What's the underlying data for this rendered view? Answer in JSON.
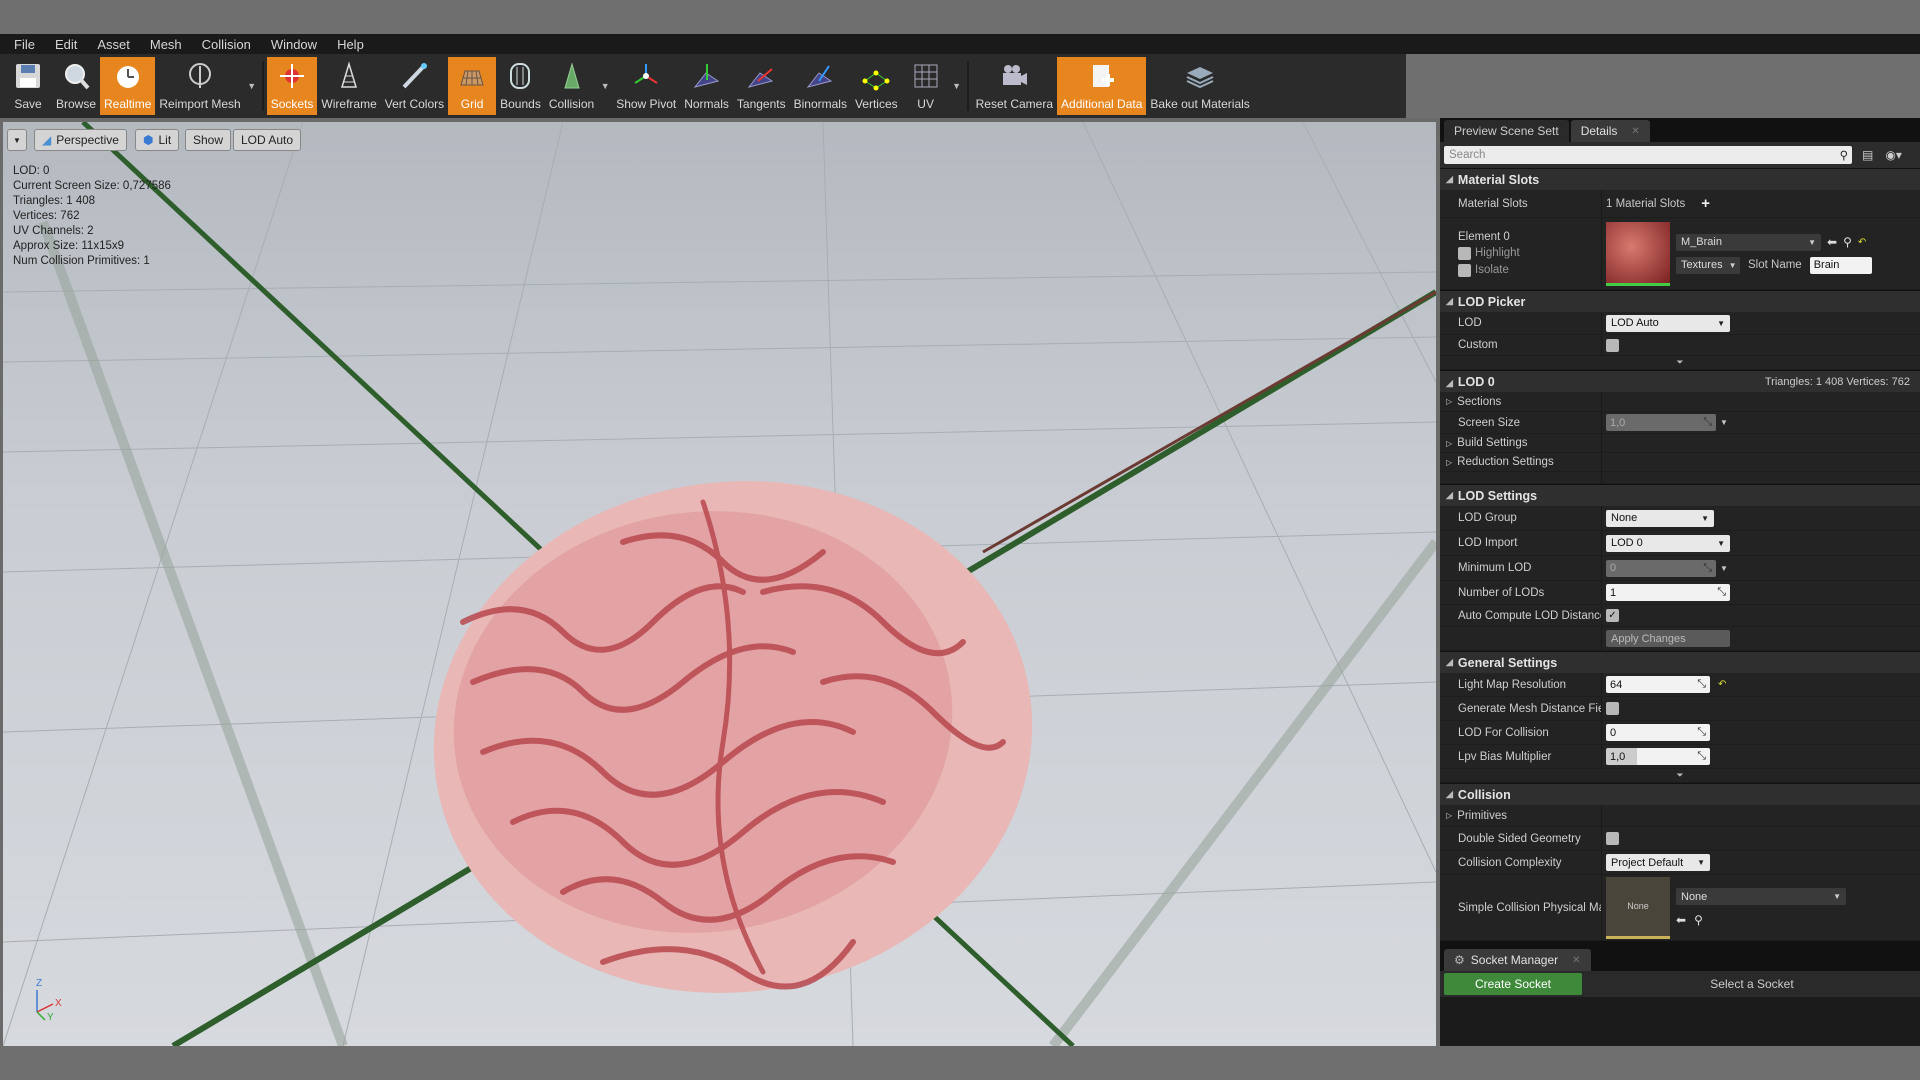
{
  "menu": [
    "File",
    "Edit",
    "Asset",
    "Mesh",
    "Collision",
    "Window",
    "Help"
  ],
  "toolbar": [
    {
      "label": "Save",
      "icon": "save-icon",
      "active": false
    },
    {
      "label": "Browse",
      "icon": "browse-icon",
      "active": false
    },
    {
      "label": "Realtime",
      "icon": "realtime-icon",
      "active": true
    },
    {
      "label": "Reimport Mesh",
      "icon": "reimport-icon",
      "active": false
    },
    {
      "label": "Sockets",
      "icon": "sockets-icon",
      "active": true
    },
    {
      "label": "Wireframe",
      "icon": "wireframe-icon",
      "active": false
    },
    {
      "label": "Vert Colors",
      "icon": "vert-colors-icon",
      "active": false
    },
    {
      "label": "Grid",
      "icon": "grid-icon",
      "active": true
    },
    {
      "label": "Bounds",
      "icon": "bounds-icon",
      "active": false
    },
    {
      "label": "Collision",
      "icon": "collision-icon",
      "active": false
    },
    {
      "label": "Show Pivot",
      "icon": "pivot-icon",
      "active": false
    },
    {
      "label": "Normals",
      "icon": "normals-icon",
      "active": false
    },
    {
      "label": "Tangents",
      "icon": "tangents-icon",
      "active": false
    },
    {
      "label": "Binormals",
      "icon": "binormals-icon",
      "active": false
    },
    {
      "label": "Vertices",
      "icon": "vertices-icon",
      "active": false
    },
    {
      "label": "UV",
      "icon": "uv-icon",
      "active": false
    },
    {
      "label": "Reset Camera",
      "icon": "camera-icon",
      "active": false
    },
    {
      "label": "Additional Data",
      "icon": "additional-data-icon",
      "active": true
    },
    {
      "label": "Bake out Materials",
      "icon": "bake-icon",
      "active": false
    }
  ],
  "viewport": {
    "perspective": "Perspective",
    "lit": "Lit",
    "show": "Show",
    "lod": "LOD Auto",
    "stats": [
      "LOD:  0",
      "Current Screen Size:  0,727586",
      "Triangles:  1 408",
      "Vertices:  762",
      "UV Channels:  2",
      "Approx Size: 11x15x9",
      "Num Collision Primitives:  1"
    ],
    "axis": {
      "z": "Z",
      "x": "X",
      "y": "Y"
    }
  },
  "panel": {
    "tabs": [
      "Preview Scene Sett",
      "Details"
    ],
    "search_placeholder": "Search",
    "material_slots": {
      "header": "Material Slots",
      "label": "Material Slots",
      "value": "1 Material Slots",
      "element": "Element 0",
      "highlight": "Highlight",
      "isolate": "Isolate",
      "material": "M_Brain",
      "textures": "Textures",
      "slot_name_label": "Slot Name",
      "slot_name": "Brain"
    },
    "lod_picker": {
      "header": "LOD Picker",
      "lod_label": "LOD",
      "lod_value": "LOD Auto",
      "custom_label": "Custom"
    },
    "lod0": {
      "header": "LOD 0",
      "stats": "Triangles: 1 408   Vertices: 762",
      "sections": "Sections",
      "screen_size_label": "Screen Size",
      "screen_size": "1,0",
      "build": "Build Settings",
      "reduction": "Reduction Settings"
    },
    "lod_settings": {
      "header": "LOD Settings",
      "group_label": "LOD Group",
      "group": "None",
      "import_label": "LOD Import",
      "import": "LOD 0",
      "min_label": "Minimum LOD",
      "min": "0",
      "num_label": "Number of LODs",
      "num": "1",
      "auto_label": "Auto Compute LOD Distance",
      "apply": "Apply Changes"
    },
    "general": {
      "header": "General Settings",
      "lightmap_label": "Light Map Resolution",
      "lightmap": "64",
      "distance_label": "Generate Mesh Distance Fiel",
      "lodcol_label": "LOD For Collision",
      "lodcol": "0",
      "lpv_label": "Lpv Bias Multiplier",
      "lpv": "1,0"
    },
    "collision": {
      "header": "Collision",
      "primitives": "Primitives",
      "double_label": "Double Sided Geometry",
      "complexity_label": "Collision Complexity",
      "complexity": "Project Default",
      "phys_label": "Simple Collision Physical Ma",
      "phys_thumb": "None",
      "phys_value": "None"
    },
    "socket_manager": {
      "tab": "Socket Manager",
      "create": "Create Socket",
      "select": "Select a Socket"
    }
  },
  "colors": {
    "accent": "#e7851f",
    "green": "#3f8a3a"
  }
}
